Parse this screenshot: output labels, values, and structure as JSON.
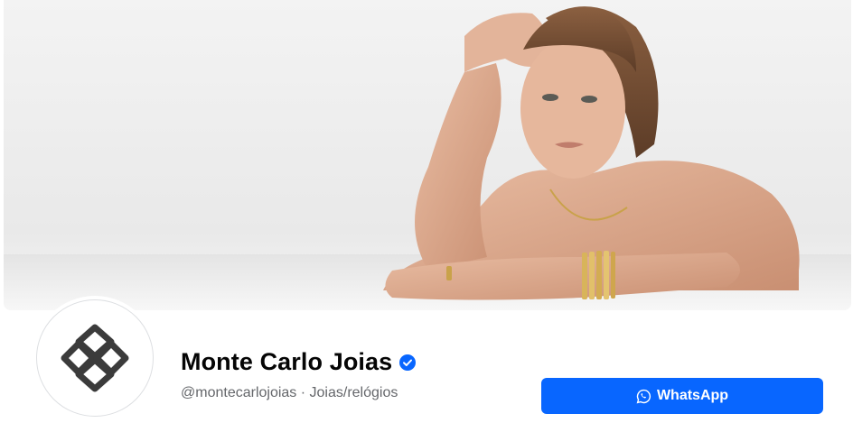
{
  "cover": {
    "image": "cover-photo-woman-with-gold-jewelry"
  },
  "profile": {
    "name": "Monte Carlo Joias",
    "handle": "@montecarlojoias",
    "separator": " · ",
    "category": "Joias/relógios",
    "verified": true,
    "avatar_icon": "monte-carlo-logo"
  },
  "actions": {
    "whatsapp_label": "WhatsApp",
    "whatsapp_icon": "whatsapp-icon"
  },
  "colors": {
    "accent": "#0866ff",
    "verified": "#0866ff",
    "name": "#050505",
    "secondary_text": "#65676b"
  }
}
